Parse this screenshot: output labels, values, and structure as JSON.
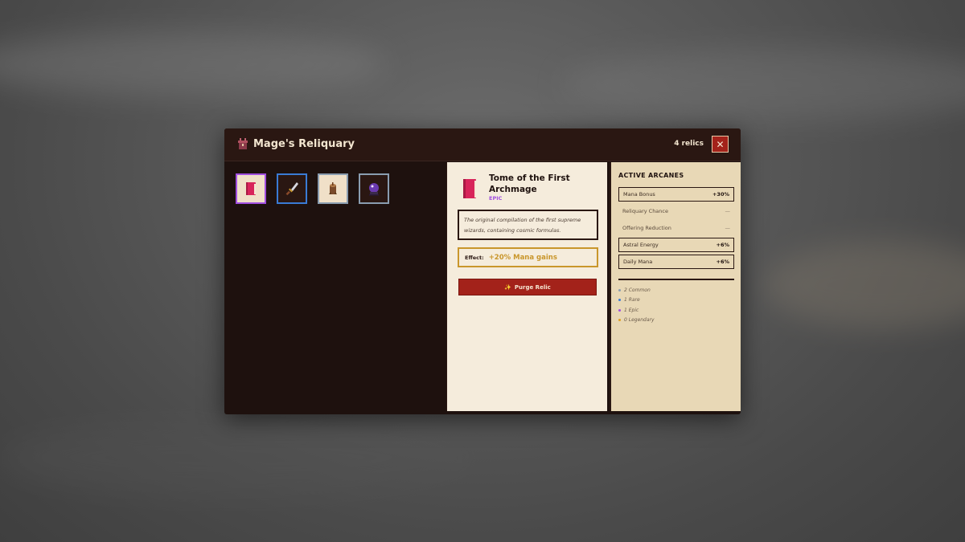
{
  "window": {
    "title": "Mage's Reliquary",
    "relic_count": "4 relics",
    "close_label": "✕"
  },
  "inventory": {
    "slots": [
      {
        "name": "tome",
        "icon": "red-book-icon",
        "border_color": "#a14fe0",
        "bg": "#f0e0c8",
        "selected": true
      },
      {
        "name": "dagger",
        "icon": "dagger-icon",
        "border_color": "#3a7bd5",
        "bg": "#2a1712",
        "selected": false
      },
      {
        "name": "stump",
        "icon": "tree-stump-icon",
        "border_color": "#8a9db0",
        "bg": "#f0e0c8",
        "selected": false
      },
      {
        "name": "orb",
        "icon": "crystal-ball-icon",
        "border_color": "#8a9db0",
        "bg": "#2a1712",
        "selected": false
      }
    ]
  },
  "detail": {
    "name": "Tome of the First Archmage",
    "rarity": "EPIC",
    "rarity_color": "#a14fe0",
    "description": "The original compilation of the first supreme wizards, containing cosmic formulas.",
    "effect_label": "Effect:",
    "effect_value": "+20% Mana gains",
    "purge_icon": "✨",
    "purge_label": "Purge Relic"
  },
  "arcanes": {
    "title": "ACTIVE ARCANES",
    "stats": [
      {
        "label": "Mana Bonus",
        "value": "+30%",
        "active": true
      },
      {
        "label": "Reliquary Chance",
        "value": "—",
        "active": false
      },
      {
        "label": "Offering Reduction",
        "value": "—",
        "active": false
      },
      {
        "label": "Astral Energy",
        "value": "+6%",
        "active": true
      },
      {
        "label": "Daily Mana",
        "value": "+6%",
        "active": true
      }
    ],
    "rarities": [
      {
        "label": "2 Common",
        "color": "#8a9db0"
      },
      {
        "label": "1 Rare",
        "color": "#3a7bd5"
      },
      {
        "label": "1 Epic",
        "color": "#a14fe0"
      },
      {
        "label": "0 Legendary",
        "color": "#e0a020"
      }
    ]
  },
  "colors": {
    "accent_red": "#a3221a",
    "gold": "#c9962b",
    "dark": "#1e110e",
    "parchment": "#f5ecdc"
  }
}
